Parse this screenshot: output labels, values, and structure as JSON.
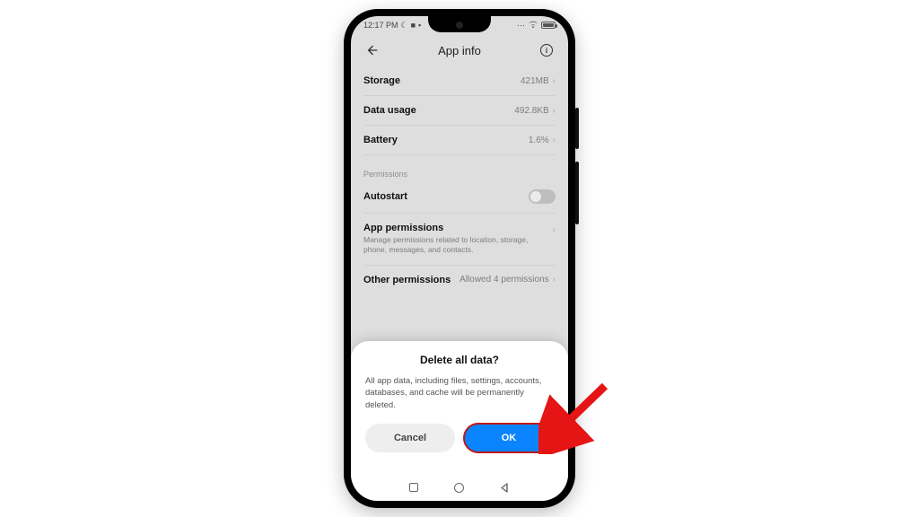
{
  "status": {
    "time": "12:17 PM",
    "left_icons": [
      "moon-icon",
      "video-icon",
      "square-icon"
    ],
    "right_icons": [
      "more-icon",
      "wifi-icon",
      "battery-icon"
    ]
  },
  "appbar": {
    "title": "App info"
  },
  "rows": {
    "storage": {
      "label": "Storage",
      "value": "421MB"
    },
    "datausage": {
      "label": "Data usage",
      "value": "492.8KB"
    },
    "battery": {
      "label": "Battery",
      "value": "1.6%"
    }
  },
  "sections": {
    "permissions_label": "Permissions",
    "autostart": {
      "label": "Autostart",
      "state": "off"
    },
    "app_permissions": {
      "label": "App permissions",
      "sub": "Manage permissions related to location, storage, phone, messages, and contacts."
    },
    "other_permissions": {
      "label": "Other permissions",
      "value": "Allowed 4 permissions"
    }
  },
  "dialog": {
    "title": "Delete all data?",
    "body": "All app data, including files, settings, accounts, databases, and cache will be permanently deleted.",
    "cancel": "Cancel",
    "ok": "OK"
  },
  "annotation": {
    "arrow_target": "ok-button"
  }
}
